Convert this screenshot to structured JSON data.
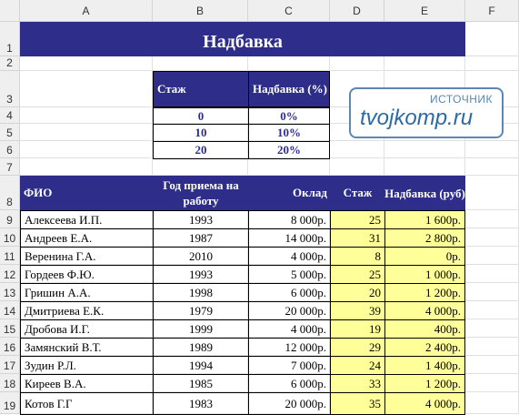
{
  "columns": [
    "A",
    "B",
    "C",
    "D",
    "E",
    "F"
  ],
  "rows": [
    "1",
    "2",
    "3",
    "4",
    "5",
    "6",
    "7",
    "8",
    "9",
    "10",
    "11",
    "12",
    "13",
    "14",
    "15",
    "16",
    "17",
    "18",
    "19"
  ],
  "title": "Надбавка",
  "bonus_table": {
    "headers": [
      "Стаж",
      "Надбавка (%)"
    ],
    "rows": [
      [
        "0",
        "0%"
      ],
      [
        "10",
        "10%"
      ],
      [
        "20",
        "20%"
      ]
    ]
  },
  "main_table": {
    "headers": {
      "fio": "ФИО",
      "year": "Год приема на работу",
      "salary": "Оклад",
      "tenure": "Стаж",
      "bonus": "Надбавка (руб)"
    },
    "rows": [
      {
        "fio": "Алексеева И.П.",
        "year": "1993",
        "salary": "8 000р.",
        "tenure": "25",
        "bonus": "1 600р."
      },
      {
        "fio": "Андреев Е.А.",
        "year": "1987",
        "salary": "14 000р.",
        "tenure": "31",
        "bonus": "2 800р."
      },
      {
        "fio": "Веренина Г.А.",
        "year": "2010",
        "salary": "4 000р.",
        "tenure": "8",
        "bonus": "0р."
      },
      {
        "fio": "Гордеев Ф.Ю.",
        "year": "1993",
        "salary": "5 000р.",
        "tenure": "25",
        "bonus": "1 000р."
      },
      {
        "fio": "Гришин А.А.",
        "year": "1998",
        "salary": "6 000р.",
        "tenure": "20",
        "bonus": "1 200р."
      },
      {
        "fio": "Дмитриева Е.К.",
        "year": "1979",
        "salary": "20 000р.",
        "tenure": "39",
        "bonus": "4 000р."
      },
      {
        "fio": "Дробова И.Г.",
        "year": "1999",
        "salary": "4 000р.",
        "tenure": "19",
        "bonus": "400р."
      },
      {
        "fio": "Замянский В.Т.",
        "year": "1989",
        "salary": "12 000р.",
        "tenure": "29",
        "bonus": "2 400р."
      },
      {
        "fio": "Зудин Р.Л.",
        "year": "1994",
        "salary": "7 000р.",
        "tenure": "24",
        "bonus": "1 400р."
      },
      {
        "fio": "Киреев В.А.",
        "year": "1985",
        "salary": "6 000р.",
        "tenure": "33",
        "bonus": "1 200р."
      },
      {
        "fio": "Котов Г.Г",
        "year": "1983",
        "salary": "20 000р.",
        "tenure": "35",
        "bonus": "4 000р."
      }
    ]
  },
  "watermark": {
    "label": "ИСТОЧНИК",
    "site": "tvojkomp.ru"
  },
  "colors": {
    "header_fill": "#2e2e8a",
    "highlight_fill": "#ffff99",
    "accent_text": "#2e2e8a"
  }
}
